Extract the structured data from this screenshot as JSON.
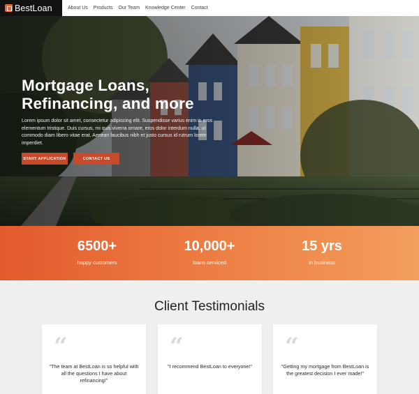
{
  "nav": {
    "brand": "BestLoan",
    "links": [
      "About Us",
      "Products",
      "Our Team",
      "Knowledge Center",
      "Contact"
    ]
  },
  "hero": {
    "title_line1": "Mortgage Loans,",
    "title_line2": "Refinancing, and more",
    "body": "Lorem ipsum dolor sit amet, consectetur adipiscing elit. Suspendisse varius enim in eros elementum tristique. Duis cursus, mi quis viverra ornare, eros dolor interdum nulla, ut commodo diam libero vitae erat. Aenean faucibus nibh et justo cursus id rutrum lorem imperdiet.",
    "primary_button": "START APPLICATION",
    "secondary_button": "CONTACT US"
  },
  "stats": [
    {
      "value": "6500+",
      "label": "happy customers"
    },
    {
      "value": "10,000+",
      "label": "loans serviced"
    },
    {
      "value": "15 yrs",
      "label": "in business"
    }
  ],
  "testimonials": {
    "title": "Client Testimonials",
    "quote_glyph": "“",
    "items": [
      {
        "text": "\"The team at BestLoan is so helpful with all the questions I have about refinancing!\""
      },
      {
        "text": "\"I recommend BestLoan to everyone!\""
      },
      {
        "text": "\"Getting my mortgage from BestLoan is the greatest decision I ever made!\""
      }
    ]
  },
  "colors": {
    "accent": "#e8673a",
    "button": "#c64a2b",
    "stats_start": "#e35a2d",
    "stats_end": "#f39e5c",
    "nav_brand_bg": "#121212"
  }
}
